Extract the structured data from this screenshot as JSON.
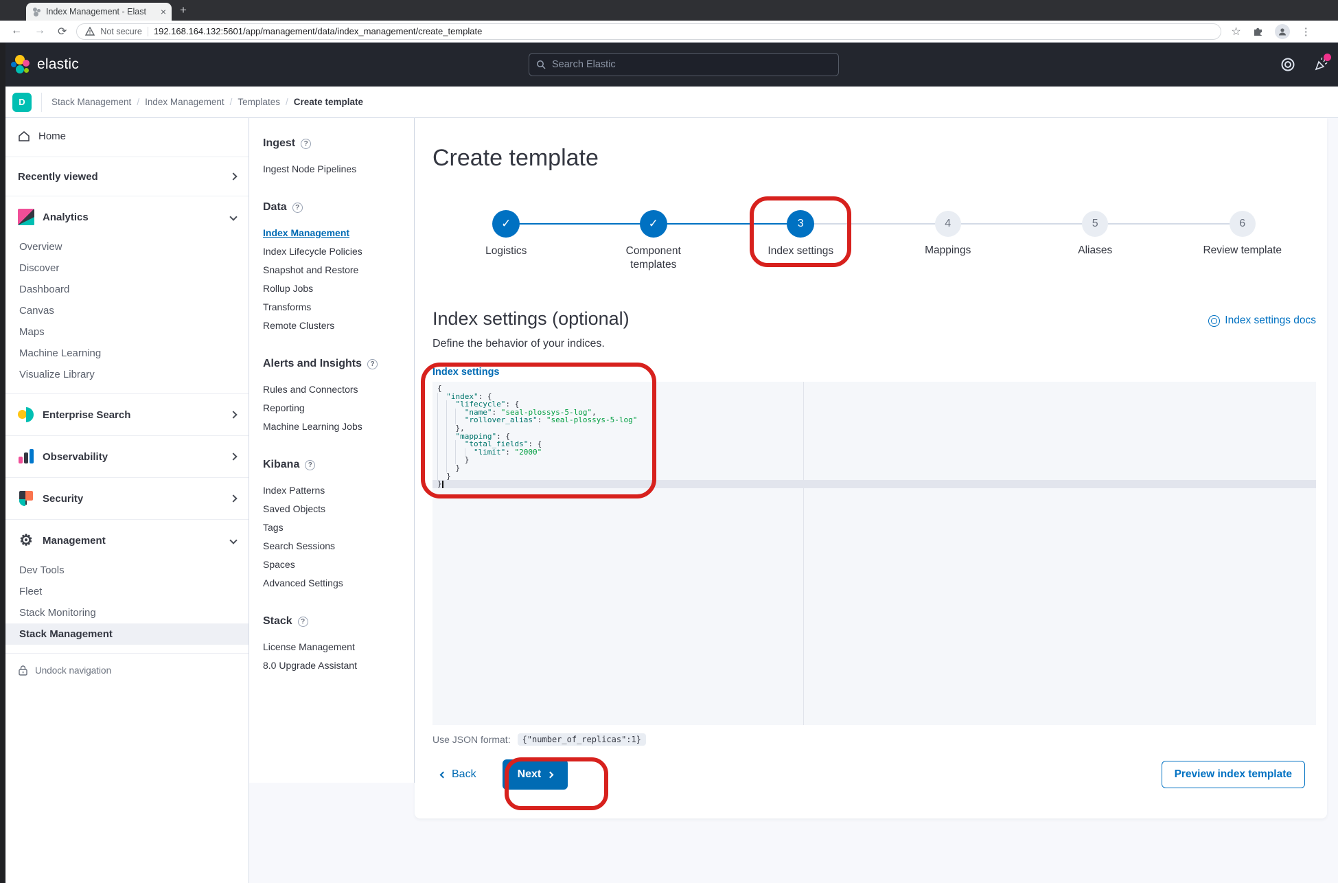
{
  "browser": {
    "tab_title": "Index Management - Elast",
    "close_label": "×",
    "new_tab_label": "+",
    "security_label": "Not secure",
    "url": "192.168.164.132:5601/app/management/data/index_management/create_template"
  },
  "header": {
    "brand": "elastic",
    "search_placeholder": "Search Elastic"
  },
  "breadcrumbs": {
    "space_initial": "D",
    "items": [
      "Stack Management",
      "Index Management",
      "Templates",
      "Create template"
    ]
  },
  "primary_nav": {
    "home": "Home",
    "recently_viewed": "Recently viewed",
    "analytics": {
      "label": "Analytics",
      "items": [
        "Overview",
        "Discover",
        "Dashboard",
        "Canvas",
        "Maps",
        "Machine Learning",
        "Visualize Library"
      ]
    },
    "enterprise_search": "Enterprise Search",
    "observability": "Observability",
    "security": "Security",
    "management": {
      "label": "Management",
      "items": [
        "Dev Tools",
        "Fleet",
        "Stack Monitoring",
        "Stack Management"
      ],
      "active_item": "Stack Management"
    },
    "undock": "Undock navigation"
  },
  "secondary_nav": {
    "ingest": {
      "title": "Ingest",
      "items": [
        "Ingest Node Pipelines"
      ]
    },
    "data": {
      "title": "Data",
      "active_item": "Index Management",
      "items": [
        "Index Management",
        "Index Lifecycle Policies",
        "Snapshot and Restore",
        "Rollup Jobs",
        "Transforms",
        "Remote Clusters"
      ]
    },
    "alerts": {
      "title": "Alerts and Insights",
      "items": [
        "Rules and Connectors",
        "Reporting",
        "Machine Learning Jobs"
      ]
    },
    "kibana": {
      "title": "Kibana",
      "items": [
        "Index Patterns",
        "Saved Objects",
        "Tags",
        "Search Sessions",
        "Spaces",
        "Advanced Settings"
      ]
    },
    "stack": {
      "title": "Stack",
      "items": [
        "License Management",
        "8.0 Upgrade Assistant"
      ]
    }
  },
  "main": {
    "title": "Create template",
    "steps": [
      {
        "num": "1",
        "icon": "✓",
        "label": "Logistics",
        "status": "complete"
      },
      {
        "num": "2",
        "icon": "✓",
        "label": "Component templates",
        "status": "complete"
      },
      {
        "num": "3",
        "label": "Index settings",
        "status": "current"
      },
      {
        "num": "4",
        "label": "Mappings",
        "status": "incomplete"
      },
      {
        "num": "5",
        "label": "Aliases",
        "status": "incomplete"
      },
      {
        "num": "6",
        "label": "Review template",
        "status": "incomplete"
      }
    ],
    "section_title": "Index settings (optional)",
    "docs_link": "Index settings docs",
    "subtitle": "Define the behavior of your indices.",
    "editor_label": "Index settings",
    "helper_prefix": "Use JSON format:",
    "helper_code": "{\"number_of_replicas\":1}",
    "back_label": "Back",
    "next_label": "Next",
    "preview_label": "Preview index template"
  },
  "editor": {
    "active_line": 12,
    "lines": [
      [
        [
          "p",
          "{"
        ]
      ],
      [
        [
          "g",
          "  "
        ],
        [
          "k",
          "\"index\""
        ],
        [
          "p",
          ": {"
        ]
      ],
      [
        [
          "g",
          "  "
        ],
        [
          "g",
          "  "
        ],
        [
          "k",
          "\"lifecycle\""
        ],
        [
          "p",
          ": {"
        ]
      ],
      [
        [
          "g",
          "  "
        ],
        [
          "g",
          "  "
        ],
        [
          "g",
          "  "
        ],
        [
          "k",
          "\"name\""
        ],
        [
          "p",
          ": "
        ],
        [
          "v",
          "\"seal-plossys-5-log\""
        ],
        [
          "p",
          ","
        ]
      ],
      [
        [
          "g",
          "  "
        ],
        [
          "g",
          "  "
        ],
        [
          "g",
          "  "
        ],
        [
          "k",
          "\"rollover_alias\""
        ],
        [
          "p",
          ": "
        ],
        [
          "v",
          "\"seal-plossys-5-log\""
        ]
      ],
      [
        [
          "g",
          "  "
        ],
        [
          "g",
          "  "
        ],
        [
          "p",
          "},"
        ]
      ],
      [
        [
          "g",
          "  "
        ],
        [
          "g",
          "  "
        ],
        [
          "k",
          "\"mapping\""
        ],
        [
          "p",
          ": {"
        ]
      ],
      [
        [
          "g",
          "  "
        ],
        [
          "g",
          "  "
        ],
        [
          "g",
          "  "
        ],
        [
          "k",
          "\"total_fields\""
        ],
        [
          "p",
          ": {"
        ]
      ],
      [
        [
          "g",
          "  "
        ],
        [
          "g",
          "  "
        ],
        [
          "g",
          "  "
        ],
        [
          "g",
          "  "
        ],
        [
          "k",
          "\"limit\""
        ],
        [
          "p",
          ": "
        ],
        [
          "v",
          "\"2000\""
        ]
      ],
      [
        [
          "g",
          "  "
        ],
        [
          "g",
          "  "
        ],
        [
          "g",
          "  "
        ],
        [
          "p",
          "}"
        ]
      ],
      [
        [
          "g",
          "  "
        ],
        [
          "g",
          "  "
        ],
        [
          "p",
          "}"
        ]
      ],
      [
        [
          "g",
          "  "
        ],
        [
          "p",
          "}"
        ]
      ],
      [
        [
          "p",
          "}"
        ]
      ]
    ]
  },
  "colors": {
    "accent_blue": "#006bb4",
    "annotation_red": "#d7211d",
    "space_avatar_teal": "#00bfb3",
    "code_key": "#00756c",
    "code_value": "#009e40"
  }
}
